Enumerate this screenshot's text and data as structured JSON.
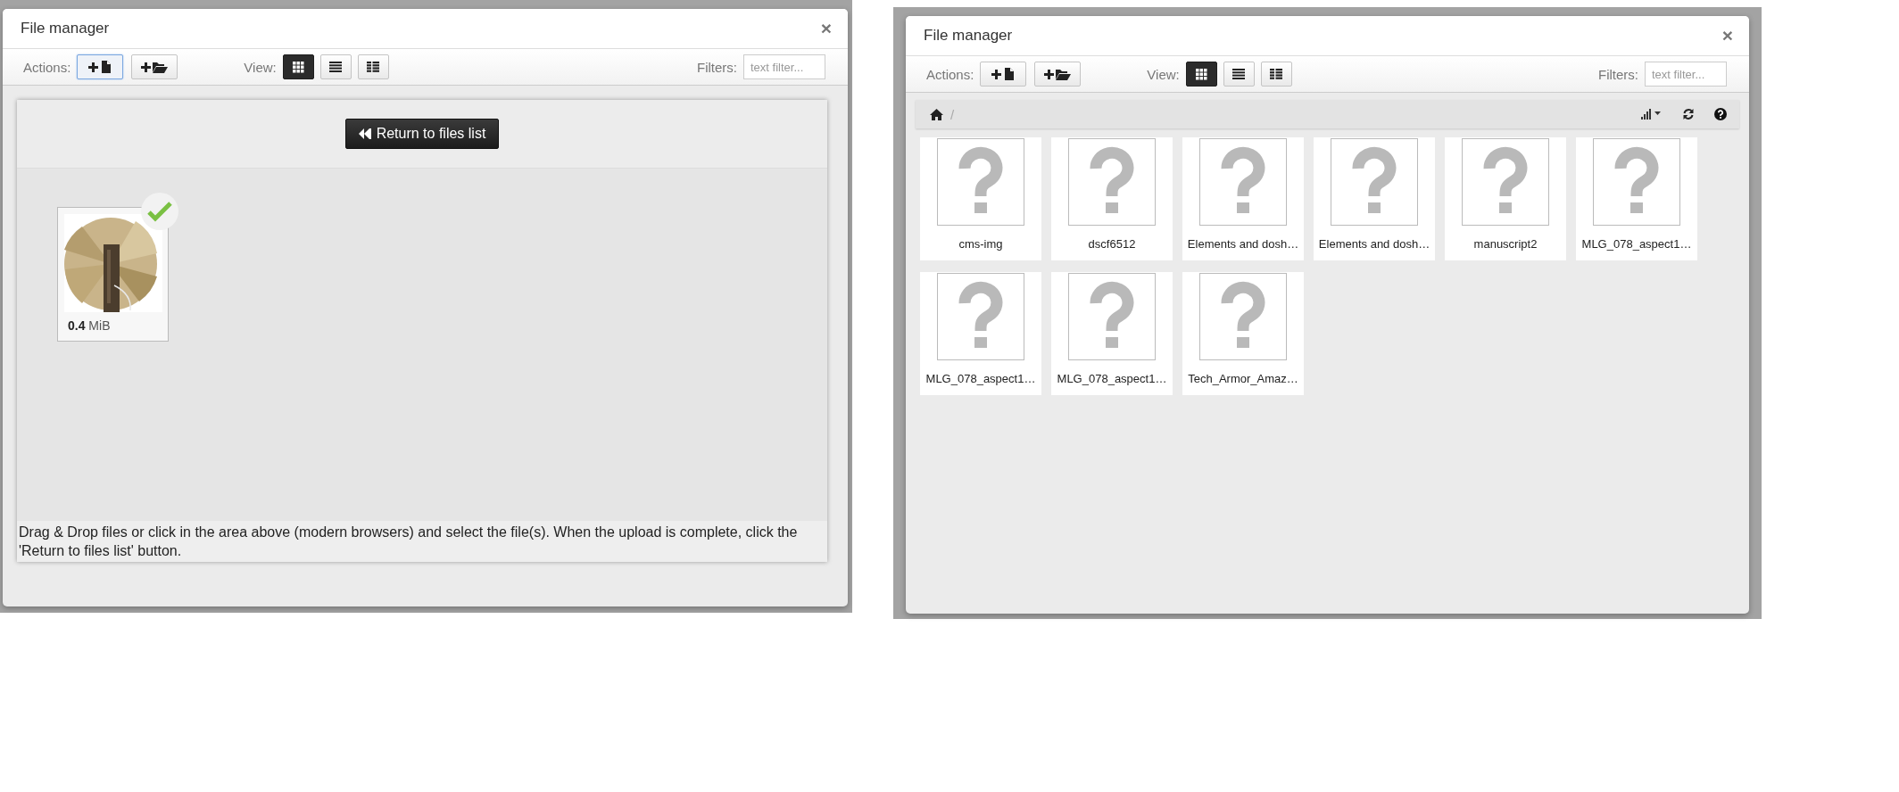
{
  "panels": [
    {
      "kind": "upload",
      "window": {
        "title": "File manager",
        "close": "×"
      },
      "toolbar": {
        "actions_label": "Actions:",
        "actions": [
          {
            "kind": "upload",
            "selected": true
          },
          {
            "kind": "folder",
            "selected": false
          }
        ],
        "view_label": "View:",
        "views": [
          {
            "kind": "grid",
            "selected": true
          },
          {
            "kind": "list",
            "selected": false
          },
          {
            "kind": "details",
            "selected": false
          }
        ],
        "filters_label": "Filters:",
        "filter": {
          "placeholder": "text filter..."
        }
      },
      "upload": {
        "return_button": "Return to files list",
        "files": [
          {
            "kind": "picture",
            "size": "**0.4** MiB",
            "done": true
          }
        ],
        "hint": "Drag & Drop files or click in the area above (modern browsers) and select the file(s). When the upload is complete, click the 'Return to files list' button."
      }
    },
    {
      "kind": "browser",
      "window": {
        "title": "File manager",
        "close": "×"
      },
      "toolbar": {
        "actions_label": "Actions:",
        "actions": [
          {
            "kind": "upload",
            "selected": false
          },
          {
            "kind": "folder",
            "selected": false
          }
        ],
        "view_label": "View:",
        "views": [
          {
            "kind": "grid",
            "selected": true
          },
          {
            "kind": "list",
            "selected": false
          },
          {
            "kind": "details",
            "selected": false
          }
        ],
        "filters_label": "Filters:",
        "filter": {
          "placeholder": "text filter..."
        }
      },
      "browser": {
        "breadcrumb_separator": "/",
        "files": [
          {
            "name": "cms-img"
          },
          {
            "name": "dscf6512"
          },
          {
            "name": "Elements and dosh…"
          },
          {
            "name": "Elements and dosh…"
          },
          {
            "name": "manuscript2"
          },
          {
            "name": "MLG_078_aspect1…"
          },
          {
            "name": "MLG_078_aspect1…"
          },
          {
            "name": "MLG_078_aspect1…"
          },
          {
            "name": "Tech_Armor_Amaz…"
          }
        ]
      }
    }
  ]
}
